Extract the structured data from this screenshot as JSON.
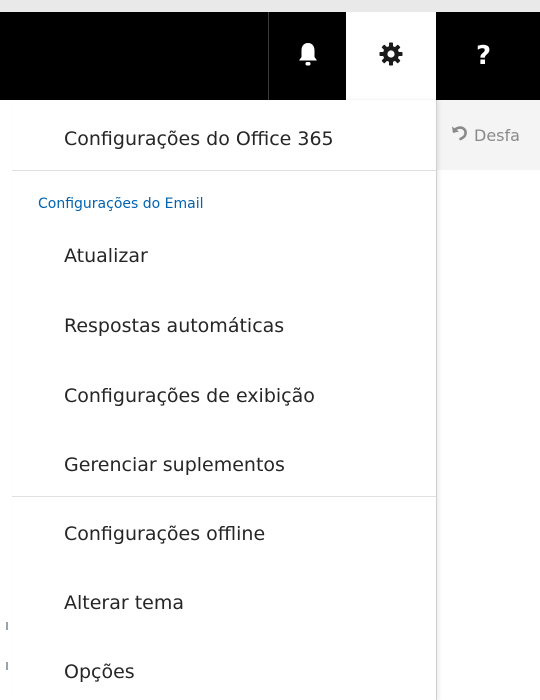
{
  "header": {
    "help_glyph": "?"
  },
  "toolbar": {
    "undo_label": "Desfa"
  },
  "menu": {
    "top_item": "Configurações do Office 365",
    "section_title": "Configurações do Email",
    "section_items": [
      "Atualizar",
      "Respostas automáticas",
      "Configurações de exibição",
      "Gerenciar suplementos"
    ],
    "bottom_items": [
      "Configurações offline",
      "Alterar tema",
      "Opções"
    ]
  },
  "colors": {
    "header_bg": "#000000",
    "section_accent": "#0063b1",
    "text": "#262626"
  }
}
